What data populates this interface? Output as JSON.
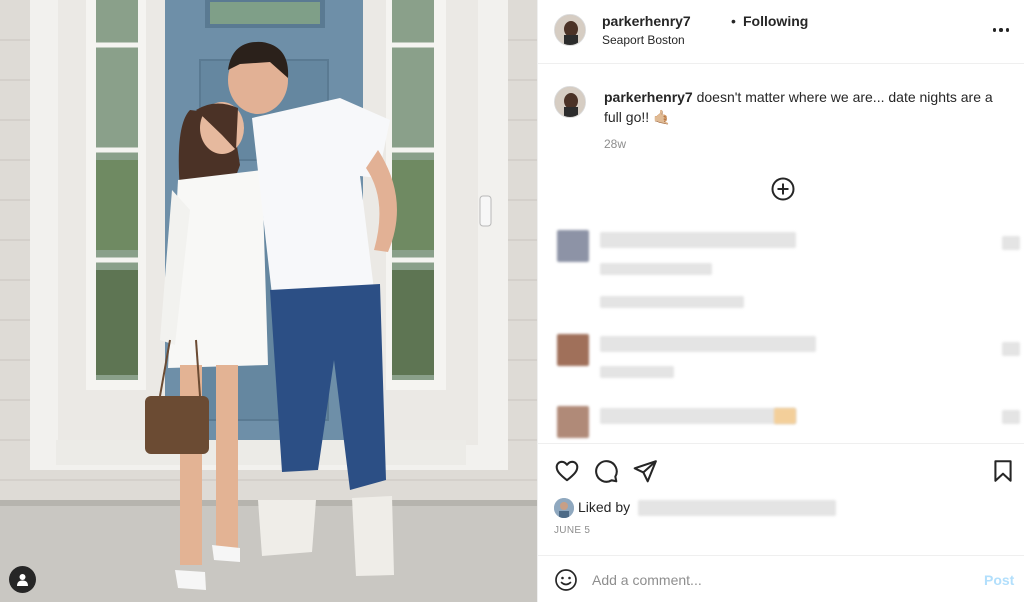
{
  "post": {
    "username": "parkerhenry7",
    "separator": "•",
    "follow_status": "Following",
    "location": "Seaport Boston"
  },
  "caption": {
    "username": "parkerhenry7",
    "text": " doesn't matter where we are... date nights are a full go!! 🤙🏼",
    "time_ago": "28w"
  },
  "engagement": {
    "liked_by_prefix": "Liked by",
    "date": "JUNE 5"
  },
  "comment_box": {
    "placeholder": "Add a comment...",
    "post_label": "Post"
  },
  "icons": {
    "more": "more-options-icon",
    "load_more": "plus-circle-icon",
    "like": "heart-icon",
    "comment": "comment-bubble-icon",
    "share": "paper-plane-icon",
    "save": "bookmark-icon",
    "emoji": "smiley-icon",
    "user_tag": "user-icon"
  },
  "colors": {
    "text_primary": "#262626",
    "text_secondary": "#8e8e8e",
    "post_disabled": "#b2dffc",
    "divider": "#efefef",
    "door_blue": "#6e8fa8"
  }
}
